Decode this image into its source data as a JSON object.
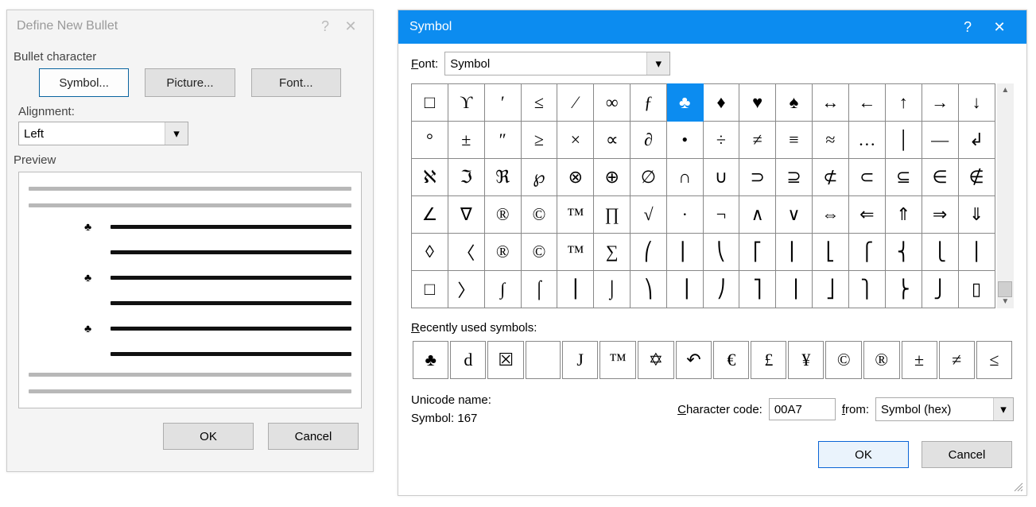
{
  "bullet_dialog": {
    "title": "Define New Bullet",
    "group_label": "Bullet character",
    "buttons": {
      "symbol": "Symbol...",
      "picture": "Picture...",
      "font": "Font..."
    },
    "alignment_label": "Alignment:",
    "alignment_value": "Left",
    "preview_label": "Preview",
    "bullet_glyph": "♣",
    "ok": "OK",
    "cancel": "Cancel"
  },
  "symbol_dialog": {
    "title": "Symbol",
    "font_label": "Font:",
    "font_value": "Symbol",
    "grid": [
      [
        "□",
        "ϒ",
        "′",
        "≤",
        "⁄",
        "∞",
        "ƒ",
        "♣",
        "♦",
        "♥",
        "♠",
        "↔",
        "←",
        "↑",
        "→",
        "↓"
      ],
      [
        "°",
        "±",
        "″",
        "≥",
        "×",
        "∝",
        "∂",
        "•",
        "÷",
        "≠",
        "≡",
        "≈",
        "…",
        "│",
        "—",
        "↲"
      ],
      [
        "ℵ",
        "ℑ",
        "ℜ",
        "℘",
        "⊗",
        "⊕",
        "∅",
        "∩",
        "∪",
        "⊃",
        "⊇",
        "⊄",
        "⊂",
        "⊆",
        "∈",
        "∉"
      ],
      [
        "∠",
        "∇",
        "®",
        "©",
        "™",
        "∏",
        "√",
        "·",
        "¬",
        "∧",
        "∨",
        "⇔",
        "⇐",
        "⇑",
        "⇒",
        "⇓"
      ],
      [
        "◊",
        "〈",
        "®",
        "©",
        "™",
        "∑",
        "⎛",
        "⎜",
        "⎝",
        "⎡",
        "⎢",
        "⎣",
        "⎧",
        "⎨",
        "⎩",
        "⎪"
      ],
      [
        "□",
        "〉",
        "∫",
        "⌠",
        "⎮",
        "⌡",
        "⎞",
        "⎟",
        "⎠",
        "⎤",
        "⎥",
        "⎦",
        "⎫",
        "⎬",
        "⎭",
        "▯"
      ]
    ],
    "selected": {
      "row": 0,
      "col": 7
    },
    "recent_label": "Recently used symbols:",
    "recent": [
      "♣",
      "d",
      "☒",
      " ",
      "J",
      "™",
      "✡",
      "↶",
      "€",
      "£",
      "¥",
      "©",
      "®",
      "±",
      "≠",
      "≤"
    ],
    "unicode_name_label": "Unicode name:",
    "unicode_name_value": "Symbol: 167",
    "char_code_label": "Character code:",
    "char_code_value": "00A7",
    "from_label": "from:",
    "from_value": "Symbol (hex)",
    "ok": "OK",
    "cancel": "Cancel"
  }
}
